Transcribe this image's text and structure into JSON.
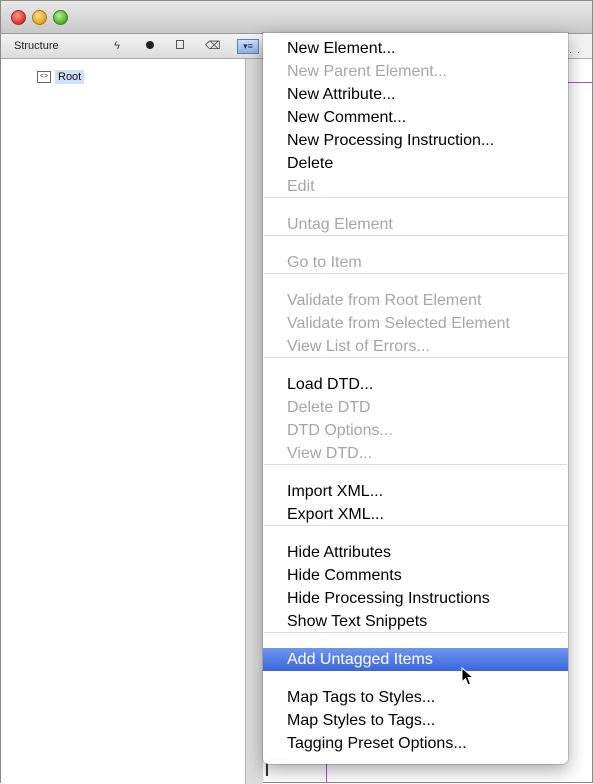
{
  "panel": {
    "title": "Structure",
    "tree": {
      "root_label": "Root"
    }
  },
  "ruler": {
    "mark": "."
  },
  "menu": {
    "items": [
      {
        "label": "New Element...",
        "enabled": true
      },
      {
        "label": "New Parent Element...",
        "enabled": false
      },
      {
        "label": "New Attribute...",
        "enabled": true
      },
      {
        "label": "New Comment...",
        "enabled": true
      },
      {
        "label": "New Processing Instruction...",
        "enabled": true
      },
      {
        "label": "Delete",
        "enabled": true
      },
      {
        "label": "Edit",
        "enabled": false
      },
      {
        "label": "Untag Element",
        "enabled": false
      },
      {
        "label": "Go to Item",
        "enabled": false
      },
      {
        "label": "Validate from Root Element",
        "enabled": false
      },
      {
        "label": "Validate from Selected Element",
        "enabled": false
      },
      {
        "label": "View List of Errors...",
        "enabled": false
      },
      {
        "label": "Load DTD...",
        "enabled": true
      },
      {
        "label": "Delete DTD",
        "enabled": false
      },
      {
        "label": "DTD Options...",
        "enabled": false
      },
      {
        "label": "View DTD...",
        "enabled": false
      },
      {
        "label": "Import XML...",
        "enabled": true
      },
      {
        "label": "Export XML...",
        "enabled": true
      },
      {
        "label": "Hide Attributes",
        "enabled": true
      },
      {
        "label": "Hide Comments",
        "enabled": true
      },
      {
        "label": "Hide Processing Instructions",
        "enabled": true
      },
      {
        "label": "Show Text Snippets",
        "enabled": true
      },
      {
        "label": "Add Untagged Items",
        "enabled": true,
        "highlighted": true
      },
      {
        "label": "Map Tags to Styles...",
        "enabled": true
      },
      {
        "label": "Map Styles to Tags...",
        "enabled": true
      },
      {
        "label": "Tagging Preset Options...",
        "enabled": true
      }
    ]
  },
  "colors": {
    "highlight": "#3a66dc",
    "disabled_text": "#a6a6a6",
    "guide": "#b050c0"
  }
}
